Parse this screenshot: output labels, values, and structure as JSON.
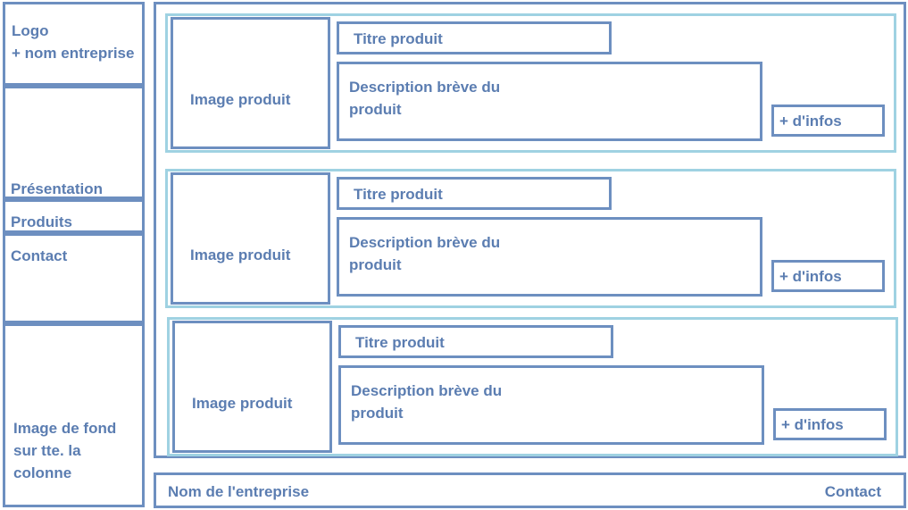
{
  "sidebar": {
    "logo": "Logo\n+ nom entreprise",
    "presentation": "Présentation",
    "produits": "Produits",
    "contact": "Contact",
    "background": "Image de fond\nsur tte. la\ncolonne"
  },
  "products": [
    {
      "image": "Image produit",
      "title": "Titre produit",
      "description": "Description brève du\nproduit",
      "more": "+ d'infos"
    },
    {
      "image": "Image produit",
      "title": "Titre produit",
      "description": "Description brève du\nproduit",
      "more": "+ d'infos"
    },
    {
      "image": "Image produit",
      "title": "Titre produit",
      "description": "Description brève du\nproduit",
      "more": "+ d'infos"
    }
  ],
  "footer": {
    "company": "Nom de l'entreprise",
    "contact": "Contact"
  },
  "colors": {
    "box_border": "#6d8fc0",
    "card_border": "#9fd2e2",
    "text": "#5b7db1"
  }
}
